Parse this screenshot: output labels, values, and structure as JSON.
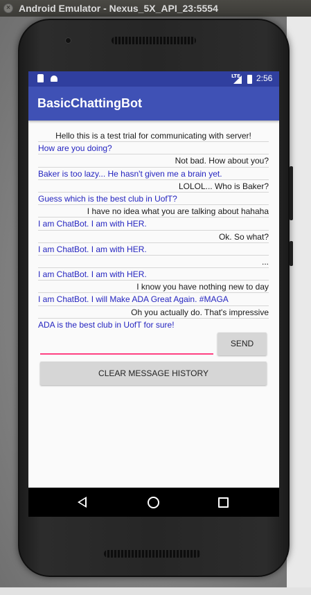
{
  "window": {
    "title": "Android Emulator - Nexus_5X_API_23:5554",
    "close_glyph": "×"
  },
  "status_bar": {
    "network": "LTE",
    "time": "2:56"
  },
  "app_bar": {
    "title": "BasicChattingBot"
  },
  "messages": [
    {
      "sender": "user",
      "text": "Hello this is a test trial for communicating with server!"
    },
    {
      "sender": "bot",
      "text": "How are you doing?"
    },
    {
      "sender": "user",
      "text": "Not bad. How about you?"
    },
    {
      "sender": "bot",
      "text": "Baker is too lazy... He hasn't given me a brain yet."
    },
    {
      "sender": "user",
      "text": "LOLOL... Who is Baker?"
    },
    {
      "sender": "bot",
      "text": "Guess which is the best club in UofT?"
    },
    {
      "sender": "user",
      "text": "I have no idea what you are talking about hahaha"
    },
    {
      "sender": "bot",
      "text": "I am ChatBot. I am with HER."
    },
    {
      "sender": "user",
      "text": "Ok. So what?"
    },
    {
      "sender": "bot",
      "text": "I am ChatBot. I am with HER."
    },
    {
      "sender": "user",
      "text": "..."
    },
    {
      "sender": "bot",
      "text": "I am ChatBot. I am with HER."
    },
    {
      "sender": "user",
      "text": "I know you have nothing new to day"
    },
    {
      "sender": "bot",
      "text": "I am ChatBot. I will Make ADA Great Again. #MAGA"
    },
    {
      "sender": "user",
      "text": "Oh you actually do. That's impressive"
    },
    {
      "sender": "bot",
      "text": "ADA is the best club in UofT for sure!"
    }
  ],
  "composer": {
    "input_value": "",
    "send_label": "SEND",
    "clear_label": "CLEAR MESSAGE HISTORY"
  },
  "colors": {
    "status_bar": "#303f9f",
    "app_bar": "#3f51b5",
    "bot_text": "#2424c0",
    "input_underline": "#ff4081"
  },
  "icons": [
    "sd-card-icon",
    "android-debug-icon",
    "signal-icon",
    "battery-icon",
    "nav-back-icon",
    "nav-home-icon",
    "nav-recent-icon"
  ]
}
